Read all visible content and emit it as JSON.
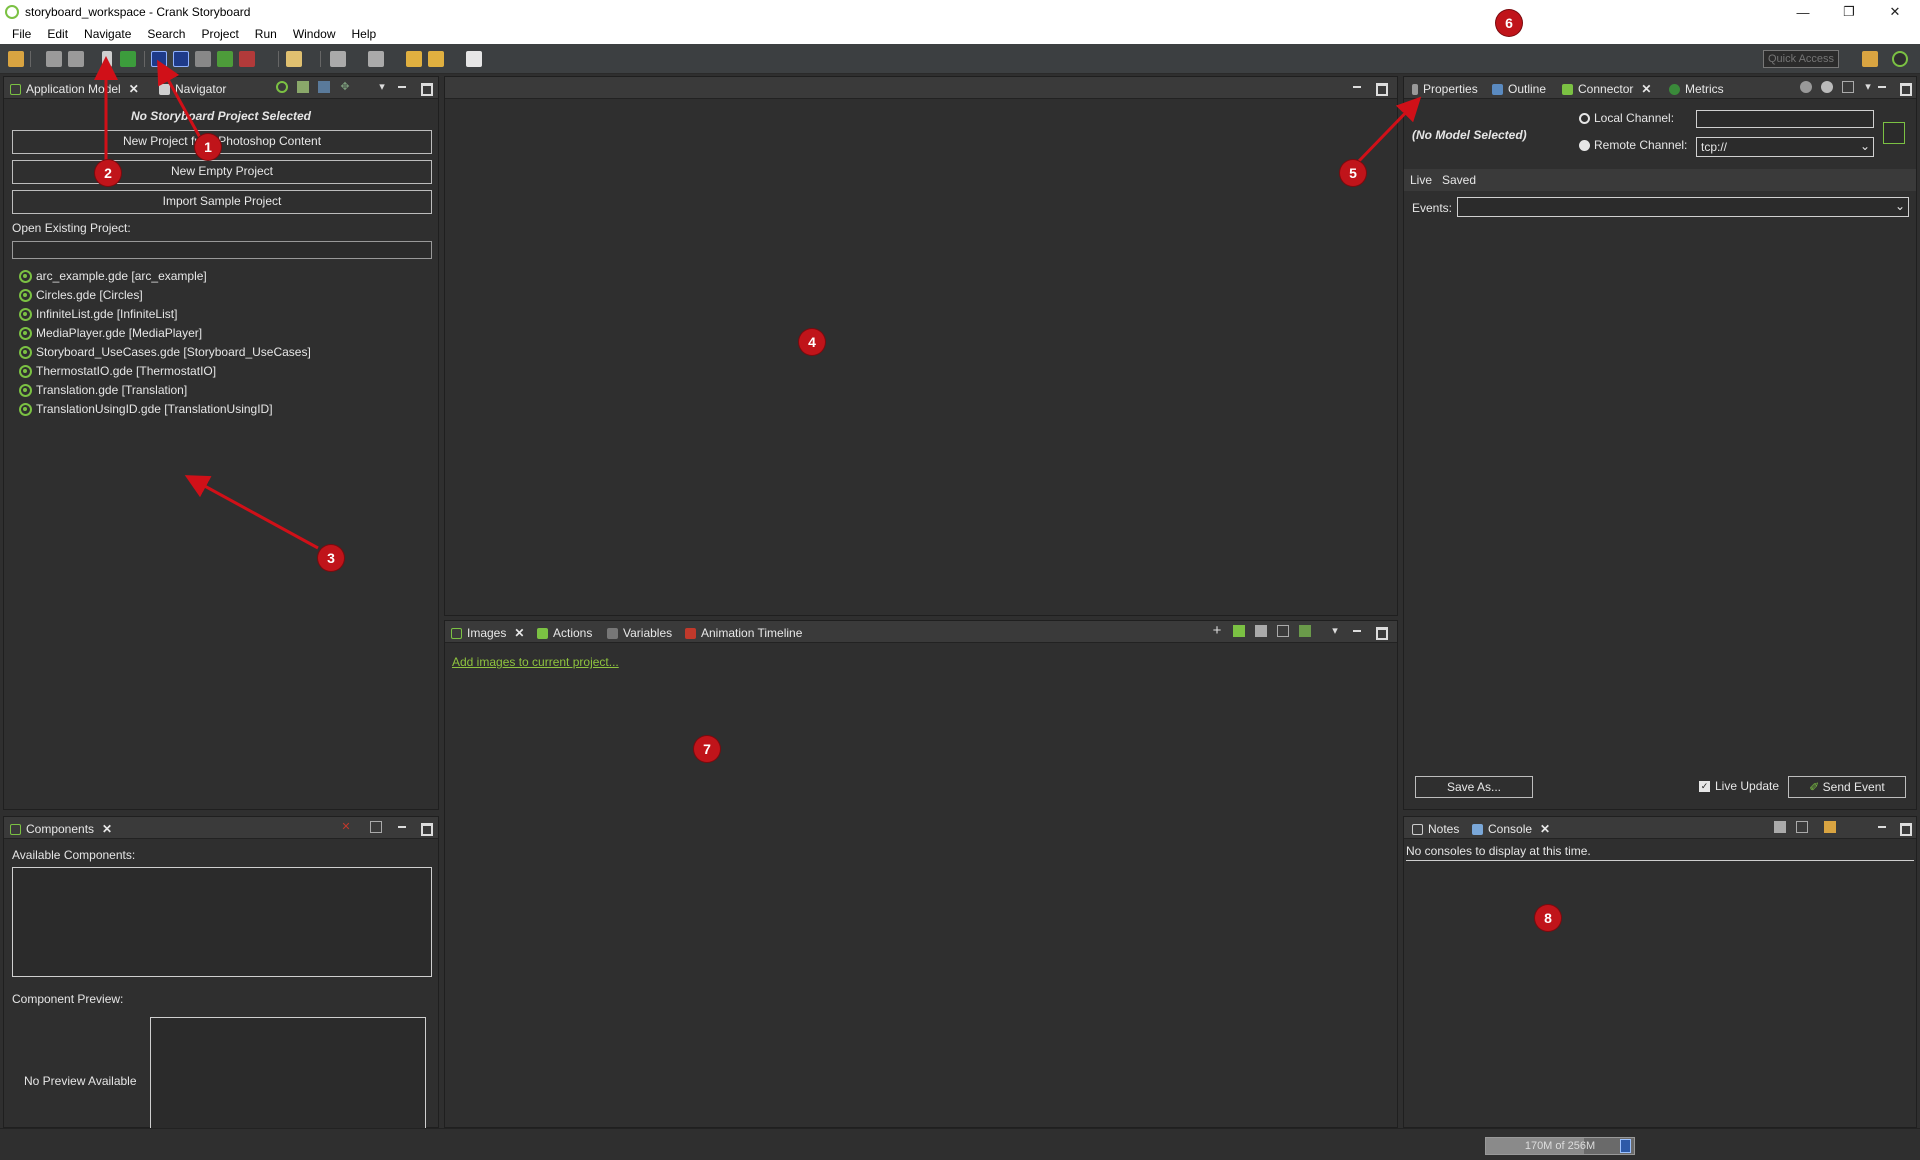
{
  "window": {
    "title": "storyboard_workspace - Crank Storyboard",
    "controls": [
      "—",
      "❐",
      "✕"
    ]
  },
  "menu": [
    "File",
    "Edit",
    "Navigate",
    "Search",
    "Project",
    "Run",
    "Window",
    "Help"
  ],
  "toolbar": {
    "quick_access_placeholder": "Quick Access"
  },
  "left_panel": {
    "tabs": [
      {
        "label": "Application Model",
        "closable": true
      },
      {
        "label": "Navigator",
        "closable": false
      }
    ],
    "no_project_label": "No Storyboard Project Selected",
    "buttons": [
      "New Project from Photoshop Content",
      "New Empty Project",
      "Import Sample Project"
    ],
    "open_existing_label": "Open Existing Project:",
    "search_value": "",
    "projects": [
      "arc_example.gde [arc_example]",
      "Circles.gde [Circles]",
      "InfiniteList.gde [InfiniteList]",
      "MediaPlayer.gde [MediaPlayer]",
      "Storyboard_UseCases.gde [Storyboard_UseCases]",
      "ThermostatIO.gde [ThermostatIO]",
      "Translation.gde [Translation]",
      "TranslationUsingID.gde [TranslationUsingID]"
    ]
  },
  "components_panel": {
    "tab": "Components",
    "available_label": "Available Components:",
    "preview_label": "Component Preview:",
    "no_preview": "No Preview Available"
  },
  "bottom_center_panel": {
    "tabs": [
      "Images",
      "Actions",
      "Variables",
      "Animation Timeline"
    ],
    "add_images_link": "Add images to current project..."
  },
  "right_panel": {
    "tabs": [
      "Properties",
      "Outline",
      "Connector",
      "Metrics"
    ],
    "no_model": "(No Model Selected)",
    "local_channel_label": "Local Channel:",
    "local_channel_value": "",
    "remote_channel_label": "Remote Channel:",
    "remote_channel_value": "tcp://",
    "subtabs": [
      "Live",
      "Saved"
    ],
    "events_label": "Events:",
    "events_value": "",
    "save_as": "Save As...",
    "live_update_label": "Live Update",
    "live_update_checked": true,
    "send_event": "Send Event"
  },
  "console_panel": {
    "tabs": [
      "Notes",
      "Console"
    ],
    "message": "No consoles to display at this time."
  },
  "status": {
    "heap_text": "170M of 256M",
    "heap_used_fraction": 0.664
  },
  "callouts": [
    "1",
    "2",
    "3",
    "4",
    "5",
    "6",
    "7",
    "8"
  ],
  "colors": {
    "accent_green": "#7bc143",
    "callout_red": "#c0141a",
    "link_green": "#8fc43f"
  }
}
